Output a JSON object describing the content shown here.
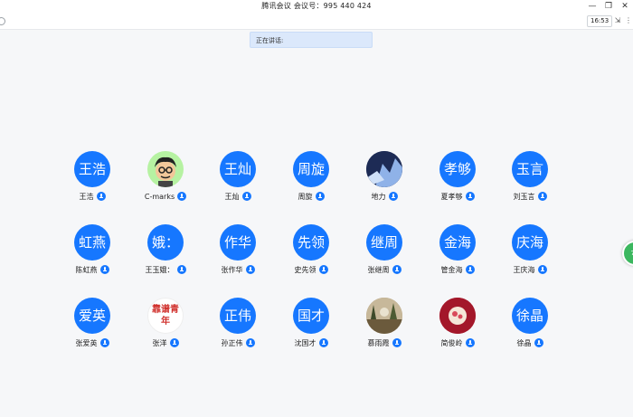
{
  "window": {
    "title": "腾讯会议  会议号：995 440 424",
    "minimize": "—",
    "restore": "❐",
    "close": "✕"
  },
  "toolbar": {
    "time": "16:53",
    "icon1": "⇲",
    "icon2": "⋮"
  },
  "speaking_label": "正在讲话:",
  "participants": [
    {
      "avatar_text": "王浩",
      "name": "王浩"
    },
    {
      "avatar_text": "",
      "name": "C-marks"
    },
    {
      "avatar_text": "王灿",
      "name": "王灿"
    },
    {
      "avatar_text": "周旋",
      "name": "周旋"
    },
    {
      "avatar_text": "",
      "name": "地力"
    },
    {
      "avatar_text": "孝够",
      "name": "夏孝够"
    },
    {
      "avatar_text": "玉言",
      "name": "刘玉言"
    },
    {
      "avatar_text": "虹燕",
      "name": "陈虹燕"
    },
    {
      "avatar_text": "娥：",
      "name": "王玉娥："
    },
    {
      "avatar_text": "作华",
      "name": "张作华"
    },
    {
      "avatar_text": "先领",
      "name": "史先领"
    },
    {
      "avatar_text": "继周",
      "name": "张继周"
    },
    {
      "avatar_text": "金海",
      "name": "管金海"
    },
    {
      "avatar_text": "庆海",
      "name": "王庆海"
    },
    {
      "avatar_text": "爱英",
      "name": "张爱英"
    },
    {
      "avatar_text": "",
      "name": "张洋"
    },
    {
      "avatar_text": "正伟",
      "name": "孙正伟"
    },
    {
      "avatar_text": "国才",
      "name": "沈国才"
    },
    {
      "avatar_text": "",
      "name": "慕雨霞"
    },
    {
      "avatar_text": "",
      "name": "简俊岭"
    },
    {
      "avatar_text": "徐晶",
      "name": "徐晶"
    }
  ],
  "image_avatar_text": {
    "zhangyang": "靠谱青年"
  },
  "float_button": "72"
}
